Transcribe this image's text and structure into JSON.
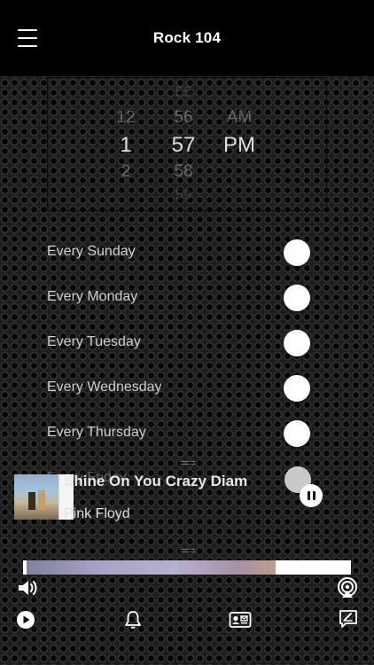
{
  "header": {
    "title": "Rock 104"
  },
  "picker": {
    "hours": [
      "",
      "12",
      "1",
      "2",
      ""
    ],
    "minutes": [
      "55",
      "56",
      "57",
      "58",
      "59"
    ],
    "ampm": [
      "",
      "AM",
      "PM",
      "",
      ""
    ]
  },
  "days": [
    {
      "label": "Every Sunday",
      "on": true
    },
    {
      "label": "Every Monday",
      "on": true
    },
    {
      "label": "Every Tuesday",
      "on": true
    },
    {
      "label": "Every Wednesday",
      "on": true
    },
    {
      "label": "Every Thursday",
      "on": true
    },
    {
      "label": "Every Friday",
      "on": true
    }
  ],
  "now_playing": {
    "title": "Shine On You Crazy Diam",
    "artist": "Pink Floyd",
    "progress": 0.77
  },
  "icons": {
    "menu": "hamburger-menu-icon",
    "pause": "pause-icon",
    "volume": "speaker-volume-icon",
    "airplay": "airplay-icon",
    "play": "play-icon",
    "alarm": "bell-icon",
    "contact": "contact-card-icon",
    "message": "compose-message-icon"
  }
}
